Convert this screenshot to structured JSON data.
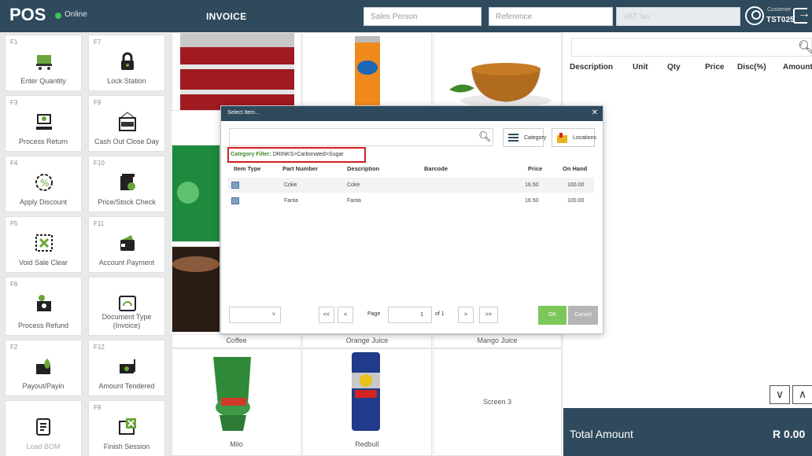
{
  "topbar": {
    "brand": "POS",
    "status": "Online",
    "title": "INVOICE",
    "sales_person_placeholder": "Sales Person",
    "reference_placeholder": "Reference",
    "vat_placeholder": "VAT No",
    "customer_label": "Customer",
    "customer_code": "TST025",
    "colors": {
      "bar": "#2e4a5c",
      "online": "#3cc35a"
    }
  },
  "fkeys": [
    {
      "code": "F1",
      "label": "Enter Quantity",
      "icon": "cart-icon"
    },
    {
      "code": "F7",
      "label": "Lock Station",
      "icon": "lock-icon"
    },
    {
      "code": "F3",
      "label": "Process Return",
      "icon": "monitor-return-icon"
    },
    {
      "code": "F9",
      "label": "Cash Out Close Day",
      "icon": "closed-sign-icon"
    },
    {
      "code": "F4",
      "label": "Apply Discount",
      "icon": "percent-icon"
    },
    {
      "code": "F10",
      "label": "Price/Stock Check",
      "icon": "price-check-icon"
    },
    {
      "code": "F5",
      "label": "Void Sale Clear",
      "icon": "void-icon"
    },
    {
      "code": "F11",
      "label": "Account Payment",
      "icon": "wallet-icon"
    },
    {
      "code": "F6",
      "label": "Process Refund",
      "icon": "refund-icon"
    },
    {
      "code": "",
      "label": "Document Type (Invoice)",
      "icon": "document-type-icon"
    },
    {
      "code": "F2",
      "label": "Payout/Payin",
      "icon": "payout-icon"
    },
    {
      "code": "F12",
      "label": "Amount Tendered",
      "icon": "tendered-icon"
    },
    {
      "code": "",
      "label": "Load BOM",
      "icon": "bom-icon"
    },
    {
      "code": "F8",
      "label": "Finish Session",
      "icon": "finish-session-icon"
    }
  ],
  "tiles": {
    "row4_labels": [
      "Coffee",
      "Orange Juice",
      "Mango Juice"
    ],
    "bottom_labels": [
      "Milo",
      "Redbull",
      "Screen 3"
    ]
  },
  "invoice": {
    "columns": [
      "Description",
      "Unit",
      "Qty",
      "Price",
      "Disc(%)",
      "Amount"
    ],
    "total_label": "Total Amount",
    "total_value": "R 0.00"
  },
  "modal": {
    "title": "Select Item...",
    "category_button": "Category",
    "locations_button": "Locations",
    "filter_label": "Category Filter:",
    "filter_value": "DRINKS>Carbonated>Sugar",
    "columns": [
      "Item Type",
      "Part Number",
      "Description",
      "Barcode",
      "Price",
      "On Hand"
    ],
    "rows": [
      {
        "part_number": "Coke",
        "description": "Coke",
        "barcode": "",
        "price": "16.50",
        "on_hand": "100.00"
      },
      {
        "part_number": "Fanta",
        "description": "Fanta",
        "barcode": "",
        "price": "16.50",
        "on_hand": "100.00"
      }
    ],
    "pager": {
      "first": "<<",
      "prev": "<",
      "page_label": "Page",
      "page": "1",
      "of_label": "of 1",
      "next": ">",
      "last": ">>"
    },
    "ok": "OK",
    "cancel": "Cancel"
  }
}
